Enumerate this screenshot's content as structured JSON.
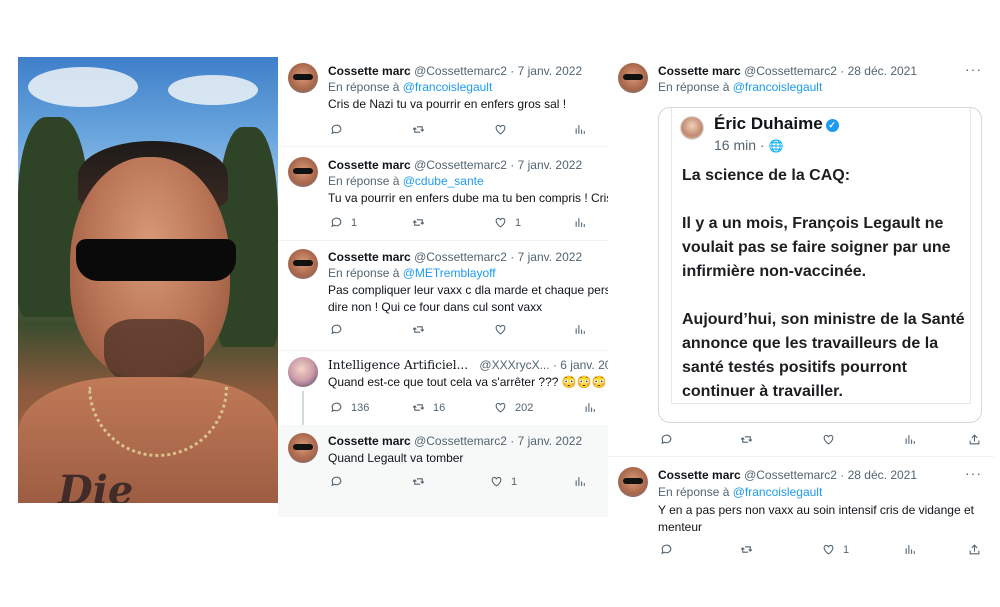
{
  "colors": {
    "link": "#1d9bf0",
    "muted": "#536471",
    "text": "#0f1419",
    "border": "#eff3f4"
  },
  "middle": {
    "tweets": [
      {
        "name": "Cossette marc",
        "handle": "@Cossettemarc2",
        "date": "· 7 janv. 2022",
        "reply_prefix": "En réponse à",
        "reply_to": "@francoislegault",
        "text": "Cris de Nazi tu va pourrir en enfers gros sal !",
        "counts": {
          "reply": "",
          "retweet": "",
          "like": ""
        }
      },
      {
        "name": "Cossette marc",
        "handle": "@Cossettemarc2",
        "date": "· 7 janv. 2022",
        "reply_prefix": "En réponse à",
        "reply_to": "@cdube_sante",
        "text": "Tu va pourrir en enfers dube ma tu ben compris ! Cris",
        "counts": {
          "reply": "1",
          "retweet": "",
          "like": "1"
        }
      },
      {
        "name": "Cossette marc",
        "handle": "@Cossettemarc2",
        "date": "· 7 janv. 2022",
        "reply_prefix": "En réponse à",
        "reply_to": "@METremblayoff",
        "text_line1": "Pas compliquer leur vaxx c dla marde et chaque pers",
        "text_line2": "dire non ! Qui ce four dans cul sont vaxx",
        "counts": {
          "reply": "",
          "retweet": "",
          "like": ""
        }
      },
      {
        "name": "Intelligence Artificiel...",
        "handle": "@XXXrycX...",
        "date": "· 6 janv. 20",
        "text": "Quand est-ce que tout cela va s'arrêter ??? 😳😳😳",
        "counts": {
          "reply": "136",
          "retweet": "16",
          "like": "202"
        }
      },
      {
        "name": "Cossette marc",
        "handle": "@Cossettemarc2",
        "date": "· 7 janv. 2022",
        "text": "Quand Legault va tomber",
        "counts": {
          "reply": "",
          "retweet": "",
          "like": "1"
        }
      }
    ]
  },
  "right": {
    "tweet1": {
      "name": "Cossette marc",
      "handle": "@Cossettemarc2",
      "date": "· 28 déc. 2021",
      "more": "···",
      "reply_prefix": "En réponse à",
      "reply_to": "@francoislegault",
      "embed": {
        "author": "Éric Duhaime",
        "verified": "✓",
        "time": "16 min · ",
        "globe": "🌐",
        "para1": "La science de la CAQ:",
        "para2": "Il y a un mois, François Legault ne voulait pas se faire soigner par une infirmière non-vaccinée.",
        "para3": "Aujourd’hui, son ministre de la Santé annonce que les travailleurs de la santé testés positifs pourront continuer à travailler."
      }
    },
    "tweet2": {
      "name": "Cossette marc",
      "handle": "@Cossettemarc2",
      "date": "· 28 déc. 2021",
      "more": "···",
      "reply_prefix": "En réponse à",
      "reply_to": "@francoislegault",
      "text_line1": "Y en a pas pers non vaxx au soin intensif cris de vidange et",
      "text_line2": "menteur",
      "counts": {
        "like": "1"
      }
    }
  }
}
